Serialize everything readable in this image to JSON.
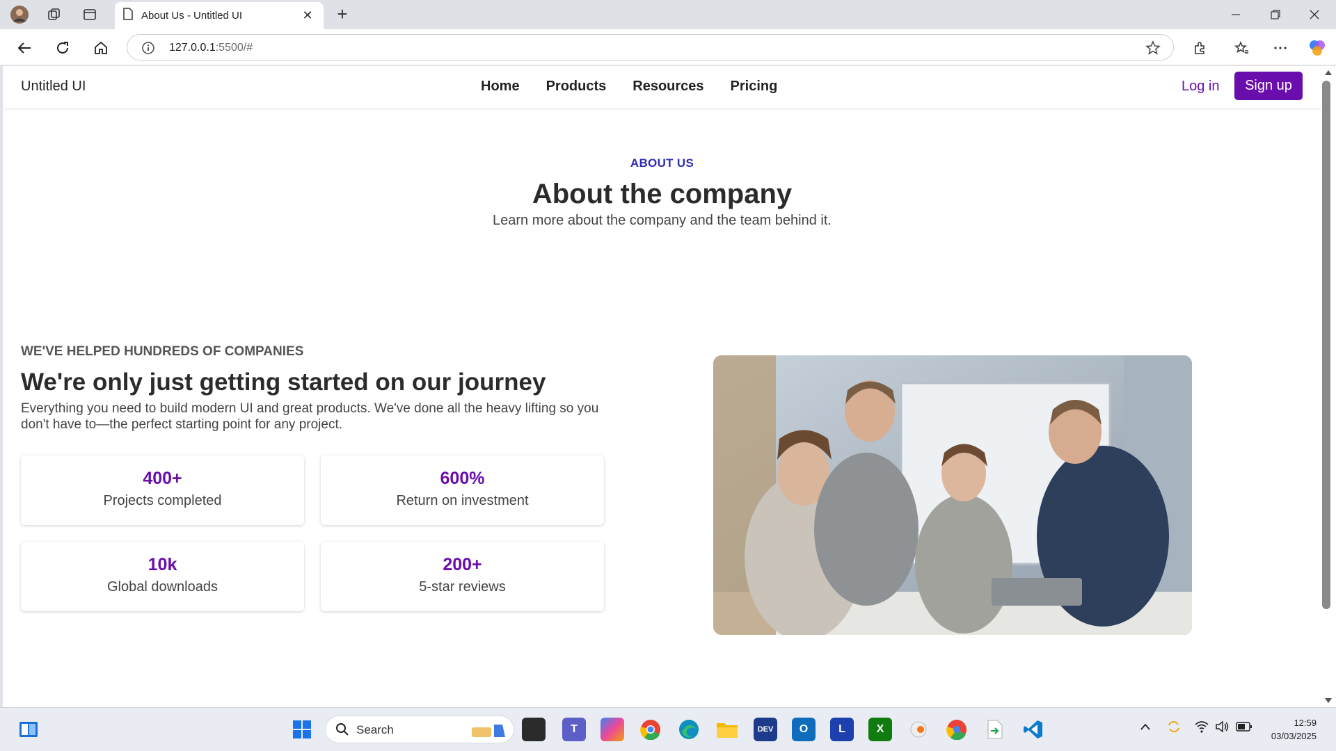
{
  "browser": {
    "tab_title": "About Us - Untitled UI",
    "url_host": "127.0.0.1",
    "url_rest": ":5500/#"
  },
  "site": {
    "brand": "Untitled UI",
    "nav": [
      "Home",
      "Products",
      "Resources",
      "Pricing"
    ],
    "login_label": "Log in",
    "signup_label": "Sign up",
    "accent_color": "#6a0dad"
  },
  "hero": {
    "eyebrow": "ABOUT US",
    "title": "About the company",
    "subtitle": "Learn more about the company and the team behind it."
  },
  "section": {
    "kicker": "WE'VE HELPED HUNDREDS OF COMPANIES",
    "title": "We're only just getting started on our journey",
    "body": "Everything you need to build modern UI and great products. We've done all the heavy lifting so you don't have to—the perfect starting point for any project."
  },
  "stats": [
    {
      "value": "400+",
      "label": "Projects completed"
    },
    {
      "value": "600%",
      "label": "Return on investment"
    },
    {
      "value": "10k",
      "label": "Global downloads"
    },
    {
      "value": "200+",
      "label": "5-star reviews"
    }
  ],
  "taskbar": {
    "search_label": "Search",
    "time": "12:59",
    "date": "03/03/2025"
  }
}
